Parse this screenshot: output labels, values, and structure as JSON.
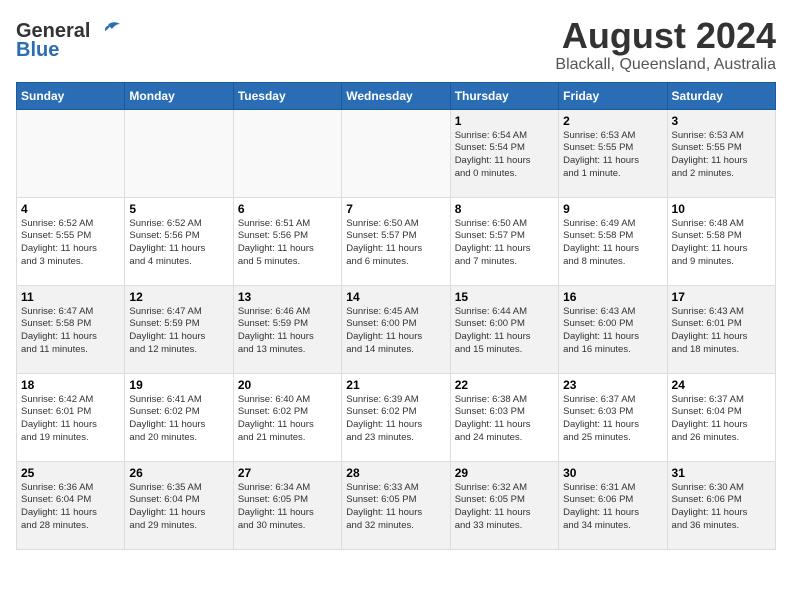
{
  "logo": {
    "general": "General",
    "blue": "Blue"
  },
  "title": "August 2024",
  "subtitle": "Blackall, Queensland, Australia",
  "headers": [
    "Sunday",
    "Monday",
    "Tuesday",
    "Wednesday",
    "Thursday",
    "Friday",
    "Saturday"
  ],
  "weeks": [
    [
      {
        "day": "",
        "info": ""
      },
      {
        "day": "",
        "info": ""
      },
      {
        "day": "",
        "info": ""
      },
      {
        "day": "",
        "info": ""
      },
      {
        "day": "1",
        "info": "Sunrise: 6:54 AM\nSunset: 5:54 PM\nDaylight: 11 hours\nand 0 minutes."
      },
      {
        "day": "2",
        "info": "Sunrise: 6:53 AM\nSunset: 5:55 PM\nDaylight: 11 hours\nand 1 minute."
      },
      {
        "day": "3",
        "info": "Sunrise: 6:53 AM\nSunset: 5:55 PM\nDaylight: 11 hours\nand 2 minutes."
      }
    ],
    [
      {
        "day": "4",
        "info": "Sunrise: 6:52 AM\nSunset: 5:55 PM\nDaylight: 11 hours\nand 3 minutes."
      },
      {
        "day": "5",
        "info": "Sunrise: 6:52 AM\nSunset: 5:56 PM\nDaylight: 11 hours\nand 4 minutes."
      },
      {
        "day": "6",
        "info": "Sunrise: 6:51 AM\nSunset: 5:56 PM\nDaylight: 11 hours\nand 5 minutes."
      },
      {
        "day": "7",
        "info": "Sunrise: 6:50 AM\nSunset: 5:57 PM\nDaylight: 11 hours\nand 6 minutes."
      },
      {
        "day": "8",
        "info": "Sunrise: 6:50 AM\nSunset: 5:57 PM\nDaylight: 11 hours\nand 7 minutes."
      },
      {
        "day": "9",
        "info": "Sunrise: 6:49 AM\nSunset: 5:58 PM\nDaylight: 11 hours\nand 8 minutes."
      },
      {
        "day": "10",
        "info": "Sunrise: 6:48 AM\nSunset: 5:58 PM\nDaylight: 11 hours\nand 9 minutes."
      }
    ],
    [
      {
        "day": "11",
        "info": "Sunrise: 6:47 AM\nSunset: 5:58 PM\nDaylight: 11 hours\nand 11 minutes."
      },
      {
        "day": "12",
        "info": "Sunrise: 6:47 AM\nSunset: 5:59 PM\nDaylight: 11 hours\nand 12 minutes."
      },
      {
        "day": "13",
        "info": "Sunrise: 6:46 AM\nSunset: 5:59 PM\nDaylight: 11 hours\nand 13 minutes."
      },
      {
        "day": "14",
        "info": "Sunrise: 6:45 AM\nSunset: 6:00 PM\nDaylight: 11 hours\nand 14 minutes."
      },
      {
        "day": "15",
        "info": "Sunrise: 6:44 AM\nSunset: 6:00 PM\nDaylight: 11 hours\nand 15 minutes."
      },
      {
        "day": "16",
        "info": "Sunrise: 6:43 AM\nSunset: 6:00 PM\nDaylight: 11 hours\nand 16 minutes."
      },
      {
        "day": "17",
        "info": "Sunrise: 6:43 AM\nSunset: 6:01 PM\nDaylight: 11 hours\nand 18 minutes."
      }
    ],
    [
      {
        "day": "18",
        "info": "Sunrise: 6:42 AM\nSunset: 6:01 PM\nDaylight: 11 hours\nand 19 minutes."
      },
      {
        "day": "19",
        "info": "Sunrise: 6:41 AM\nSunset: 6:02 PM\nDaylight: 11 hours\nand 20 minutes."
      },
      {
        "day": "20",
        "info": "Sunrise: 6:40 AM\nSunset: 6:02 PM\nDaylight: 11 hours\nand 21 minutes."
      },
      {
        "day": "21",
        "info": "Sunrise: 6:39 AM\nSunset: 6:02 PM\nDaylight: 11 hours\nand 23 minutes."
      },
      {
        "day": "22",
        "info": "Sunrise: 6:38 AM\nSunset: 6:03 PM\nDaylight: 11 hours\nand 24 minutes."
      },
      {
        "day": "23",
        "info": "Sunrise: 6:37 AM\nSunset: 6:03 PM\nDaylight: 11 hours\nand 25 minutes."
      },
      {
        "day": "24",
        "info": "Sunrise: 6:37 AM\nSunset: 6:04 PM\nDaylight: 11 hours\nand 26 minutes."
      }
    ],
    [
      {
        "day": "25",
        "info": "Sunrise: 6:36 AM\nSunset: 6:04 PM\nDaylight: 11 hours\nand 28 minutes."
      },
      {
        "day": "26",
        "info": "Sunrise: 6:35 AM\nSunset: 6:04 PM\nDaylight: 11 hours\nand 29 minutes."
      },
      {
        "day": "27",
        "info": "Sunrise: 6:34 AM\nSunset: 6:05 PM\nDaylight: 11 hours\nand 30 minutes."
      },
      {
        "day": "28",
        "info": "Sunrise: 6:33 AM\nSunset: 6:05 PM\nDaylight: 11 hours\nand 32 minutes."
      },
      {
        "day": "29",
        "info": "Sunrise: 6:32 AM\nSunset: 6:05 PM\nDaylight: 11 hours\nand 33 minutes."
      },
      {
        "day": "30",
        "info": "Sunrise: 6:31 AM\nSunset: 6:06 PM\nDaylight: 11 hours\nand 34 minutes."
      },
      {
        "day": "31",
        "info": "Sunrise: 6:30 AM\nSunset: 6:06 PM\nDaylight: 11 hours\nand 36 minutes."
      }
    ]
  ]
}
